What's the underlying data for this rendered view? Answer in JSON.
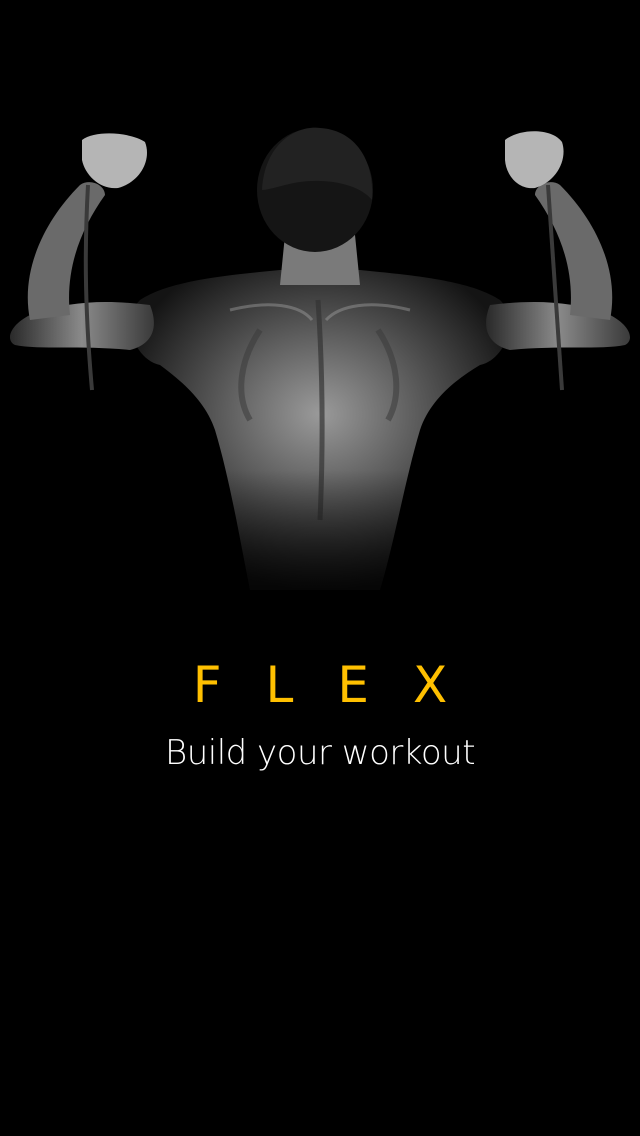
{
  "splash": {
    "title": "FLEX",
    "tagline": "Build your workout",
    "hero_image": "man-back-resistance-band-photo"
  },
  "colors": {
    "background": "#000000",
    "title": "#FFC000",
    "tagline": "#FFFFFF"
  }
}
